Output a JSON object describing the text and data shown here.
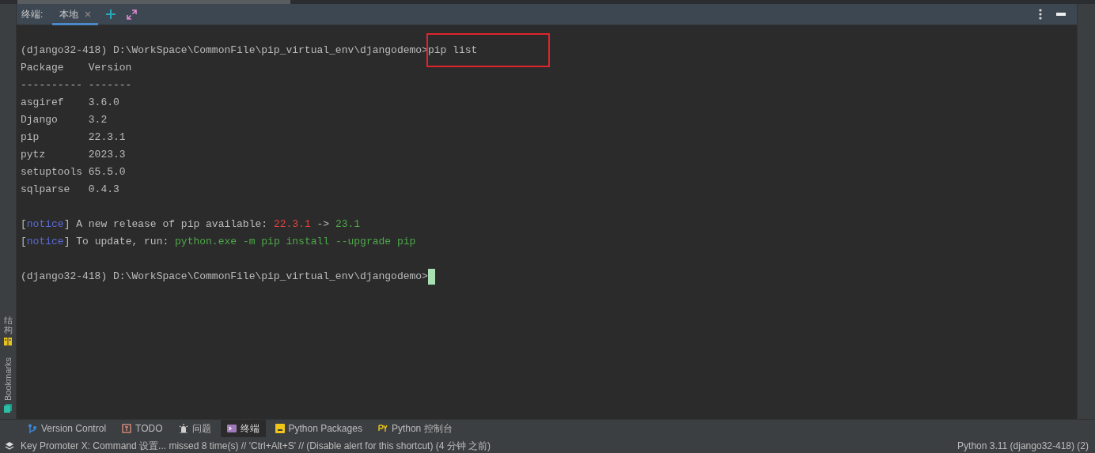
{
  "header": {
    "label": "终端:",
    "tabs": [
      {
        "label": "本地",
        "selected": true,
        "closable": true
      }
    ]
  },
  "left_stripe": [
    {
      "label": "结构",
      "kind": "structure"
    },
    {
      "label": "Bookmarks",
      "kind": "bookmarks"
    }
  ],
  "terminal": {
    "lines": [
      {
        "segments": [
          {
            "text": "(django32-418) D:\\WorkSpace\\CommonFile\\pip_virtual_env\\djangodemo>",
            "kind": "plain"
          },
          {
            "text": "pip list",
            "kind": "plain",
            "highlighted": true
          }
        ]
      },
      {
        "segments": [
          {
            "text": "Package    Version",
            "kind": "plain"
          }
        ]
      },
      {
        "segments": [
          {
            "text": "---------- -------",
            "kind": "plain"
          }
        ]
      },
      {
        "segments": [
          {
            "text": "asgiref    3.6.0",
            "kind": "plain"
          }
        ]
      },
      {
        "segments": [
          {
            "text": "Django     3.2",
            "kind": "plain"
          }
        ]
      },
      {
        "segments": [
          {
            "text": "pip        22.3.1",
            "kind": "plain"
          }
        ]
      },
      {
        "segments": [
          {
            "text": "pytz       2023.3",
            "kind": "plain"
          }
        ]
      },
      {
        "segments": [
          {
            "text": "setuptools 65.5.0",
            "kind": "plain"
          }
        ]
      },
      {
        "segments": [
          {
            "text": "sqlparse   0.4.3",
            "kind": "plain"
          }
        ]
      },
      {
        "blank_line_before": true,
        "segments": [
          {
            "text": "[",
            "kind": "plain"
          },
          {
            "text": "notice",
            "kind": "notice"
          },
          {
            "text": "] A new release of pip available: ",
            "kind": "plain"
          },
          {
            "text": "22.3.1",
            "kind": "old"
          },
          {
            "text": " -> ",
            "kind": "plain"
          },
          {
            "text": "23.1",
            "kind": "new"
          }
        ]
      },
      {
        "segments": [
          {
            "text": "[",
            "kind": "plain"
          },
          {
            "text": "notice",
            "kind": "notice"
          },
          {
            "text": "] To update, run: ",
            "kind": "plain"
          },
          {
            "text": "python.exe -m pip install --upgrade pip",
            "kind": "new"
          }
        ]
      },
      {
        "blank_line_before": true,
        "segments": [
          {
            "text": "(django32-418) D:\\WorkSpace\\CommonFile\\pip_virtual_env\\djangodemo>",
            "kind": "plain"
          }
        ],
        "cursor": true
      }
    ]
  },
  "tool_windows": [
    {
      "label": "Version Control",
      "kind": "vcs",
      "selected": false
    },
    {
      "label": "TODO",
      "kind": "todo",
      "selected": false
    },
    {
      "label": "问题",
      "kind": "problems",
      "selected": false
    },
    {
      "label": "终端",
      "kind": "terminal",
      "selected": true
    },
    {
      "label": "Python Packages",
      "kind": "packages",
      "selected": false
    },
    {
      "label": "Python 控制台",
      "kind": "console",
      "selected": false
    }
  ],
  "status_bar": {
    "message": "Key Promoter X: Command 设置... missed 8 time(s) // 'Ctrl+Alt+S' // (Disable alert for this shortcut) (4 分钟 之前)",
    "interpreter": "Python 3.11 (django32-418) (2)"
  }
}
